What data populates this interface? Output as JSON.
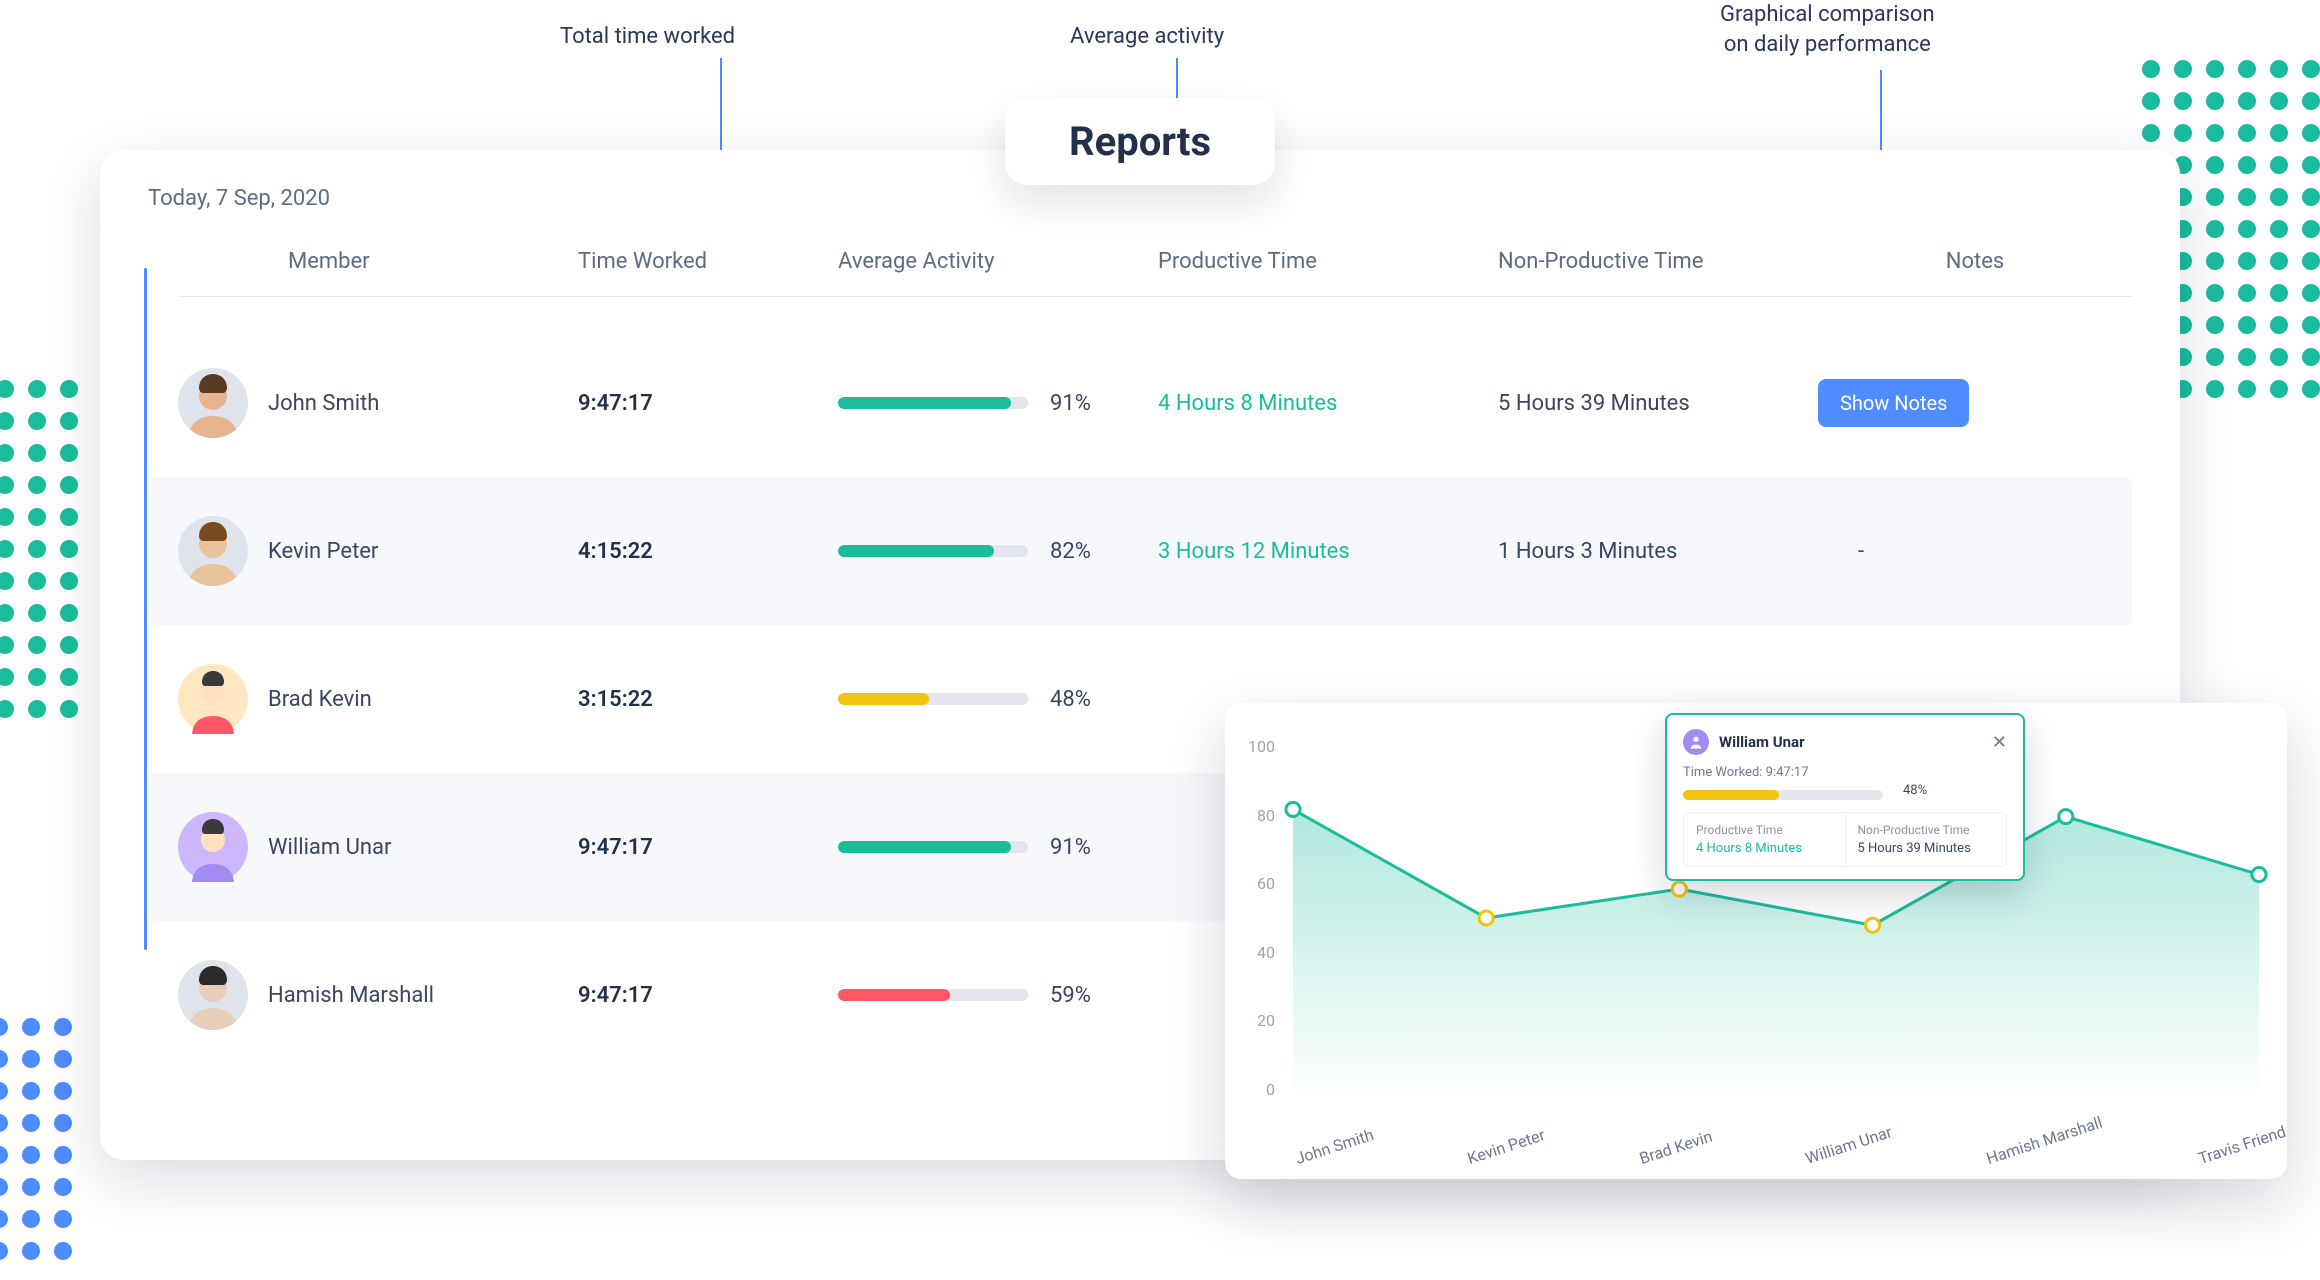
{
  "annotations": {
    "time_worked": "Total time worked",
    "avg_activity": "Average activity",
    "graph": "Graphical comparison\non daily performance"
  },
  "page": {
    "title": "Reports",
    "date": "Today, 7 Sep, 2020"
  },
  "columns": {
    "member": "Member",
    "time_worked": "Time Worked",
    "avg_activity": "Average Activity",
    "productive": "Productive Time",
    "nonproductive": "Non-Productive Time",
    "notes": "Notes"
  },
  "buttons": {
    "show_notes": "Show Notes"
  },
  "rows": [
    {
      "name": "John Smith",
      "time": "9:47:17",
      "pct": 91,
      "color": "#1abc9c",
      "productive": "4 Hours 8 Minutes",
      "nonproductive": "5 Hours 39 Minutes",
      "notes": "button",
      "avatar": "photo1"
    },
    {
      "name": "Kevin Peter",
      "time": "4:15:22",
      "pct": 82,
      "color": "#1abc9c",
      "productive": "3 Hours 12 Minutes",
      "nonproductive": "1 Hours 3 Minutes",
      "notes": "-",
      "avatar": "photo2"
    },
    {
      "name": "Brad Kevin",
      "time": "3:15:22",
      "pct": 48,
      "color": "#f1c40f",
      "productive": "",
      "nonproductive": "",
      "notes": "",
      "avatar": "illus_red"
    },
    {
      "name": "William Unar",
      "time": "9:47:17",
      "pct": 91,
      "color": "#1abc9c",
      "productive": "",
      "nonproductive": "",
      "notes": "",
      "avatar": "illus_purple"
    },
    {
      "name": "Hamish Marshall",
      "time": "9:47:17",
      "pct": 59,
      "color": "#ff5864",
      "productive": "",
      "nonproductive": "",
      "notes": "",
      "avatar": "photo3"
    }
  ],
  "chart_data": {
    "type": "area",
    "title": "",
    "xlabel": "",
    "ylabel": "",
    "ylim": [
      0,
      100
    ],
    "yticks": [
      0,
      20,
      40,
      60,
      80,
      100
    ],
    "categories": [
      "John Smith",
      "Kevin Peter",
      "Brad Kevin",
      "William Unar",
      "Hamish Marshall",
      "Travis Friend"
    ],
    "values": [
      80,
      50,
      58,
      48,
      78,
      62
    ]
  },
  "tooltip": {
    "name": "William Unar",
    "time_worked_label": "Time Worked:",
    "time_worked": "9:47:17",
    "pct": 48,
    "productive_label": "Productive Time",
    "productive": "4 Hours 8 Minutes",
    "nonproductive_label": "Non-Productive Time",
    "nonproductive": "5 Hours 39 Minutes"
  }
}
